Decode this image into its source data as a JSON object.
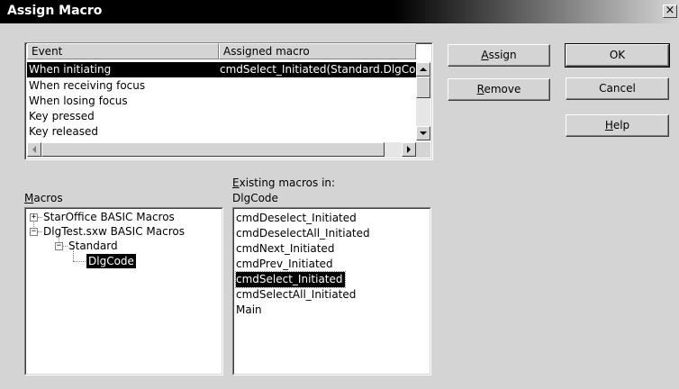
{
  "window": {
    "title": "Assign Macro",
    "close_glyph": "×"
  },
  "events_table": {
    "columns": [
      "Event",
      "Assigned macro"
    ],
    "rows": [
      {
        "event": "When initiating",
        "macro": "cmdSelect_Initiated(Standard.DlgCod",
        "selected": true
      },
      {
        "event": "When receiving focus",
        "macro": ""
      },
      {
        "event": "When losing focus",
        "macro": ""
      },
      {
        "event": "Key pressed",
        "macro": ""
      },
      {
        "event": "Key released",
        "macro": ""
      }
    ]
  },
  "buttons": {
    "assign": {
      "mnemonic": "A",
      "rest": "ssign"
    },
    "remove": {
      "mnemonic": "R",
      "rest": "emove"
    },
    "ok": "OK",
    "cancel": "Cancel",
    "help": {
      "mnemonic": "H",
      "rest": "elp"
    }
  },
  "macros_label": {
    "mnemonic": "M",
    "rest": "acros"
  },
  "tree": [
    {
      "label": "StarOffice BASIC Macros",
      "expander": "+"
    },
    {
      "label": "DlgTest.sxw BASIC Macros",
      "expander": "−"
    },
    {
      "label": "Standard",
      "expander": "−"
    },
    {
      "label": "DlgCode",
      "selected": true
    }
  ],
  "existing_label": {
    "mnemonic": "E",
    "rest": "xisting macros in:",
    "library": "DlgCode"
  },
  "macro_list": [
    {
      "label": "cmdDeselect_Initiated"
    },
    {
      "label": "cmdDeselectAll_Initiated"
    },
    {
      "label": "cmdNext_Initiated"
    },
    {
      "label": "cmdPrev_Initiated"
    },
    {
      "label": "cmdSelect_Initiated",
      "selected": true
    },
    {
      "label": "cmdSelectAll_Initiated"
    },
    {
      "label": "Main"
    }
  ]
}
